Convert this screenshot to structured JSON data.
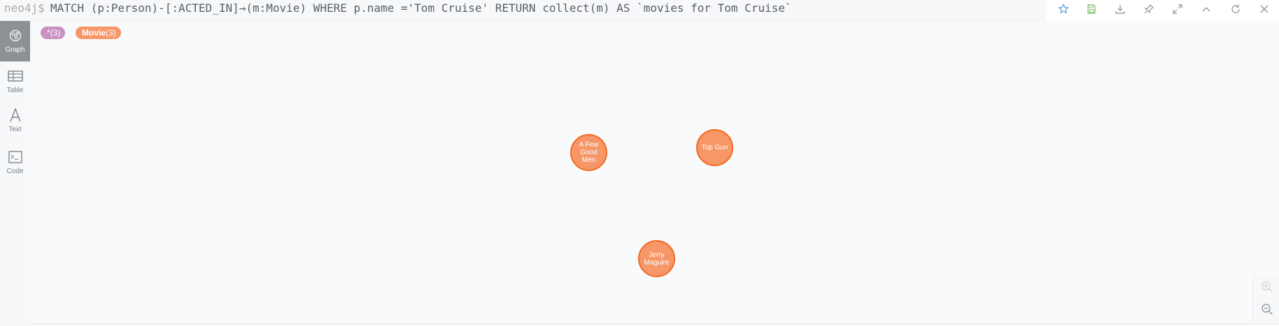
{
  "query": {
    "prompt": "neo4j$",
    "text": "MATCH (p:Person)-[:ACTED_IN]→(m:Movie) WHERE p.name ='Tom Cruise' RETURN collect(m) AS `movies for Tom Cruise`"
  },
  "toolbar": {
    "buttons": [
      "star-icon",
      "save-icon",
      "download-icon",
      "pin-icon",
      "expand-icon",
      "collapse-icon",
      "refresh-icon",
      "close-icon"
    ]
  },
  "sidebar": {
    "items": [
      {
        "label": "Graph",
        "icon": "graph-icon",
        "active": true
      },
      {
        "label": "Table",
        "icon": "table-icon",
        "active": false
      },
      {
        "label": "Text",
        "icon": "text-icon",
        "active": false
      },
      {
        "label": "Code",
        "icon": "code-icon",
        "active": false
      }
    ]
  },
  "legend": {
    "all": {
      "label": "*(3)",
      "color": "#c990c0"
    },
    "movie": {
      "name": "Movie",
      "count": "(3)",
      "color": "#f79767"
    }
  },
  "graph": {
    "nodes": [
      {
        "label": "A Few Good Men",
        "line1": "A Few",
        "line2": "Good",
        "line3": "Men"
      },
      {
        "label": "Top Gun",
        "line1": "Top Gun"
      },
      {
        "label": "Jerry Maguire",
        "line1": "Jerry",
        "line2": "Maguire"
      }
    ]
  },
  "zoom": {
    "buttons": [
      "zoom-in-icon",
      "zoom-out-icon"
    ]
  }
}
